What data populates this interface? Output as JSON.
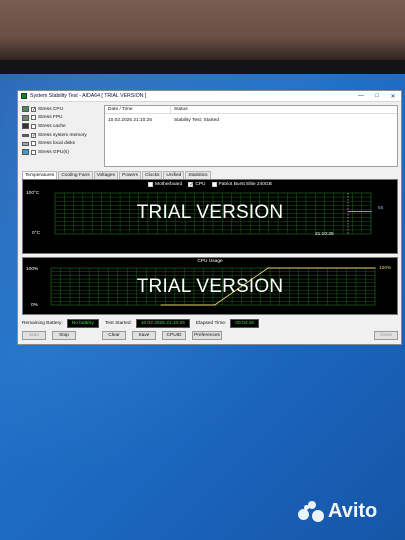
{
  "window": {
    "title": "System Stability Test - AIDA64  [ TRIAL VERSION ]",
    "minimize": "—",
    "maximize": "□",
    "close": "✕"
  },
  "options": [
    {
      "label": "Stress CPU",
      "checked": true
    },
    {
      "label": "Stress FPU",
      "checked": false
    },
    {
      "label": "Stress cache",
      "checked": false
    },
    {
      "label": "Stress system memory",
      "checked": true
    },
    {
      "label": "Stress local disks",
      "checked": false
    },
    {
      "label": "Stress GPU(s)",
      "checked": false
    }
  ],
  "log": {
    "col_date": "Date / Time",
    "col_status": "Status",
    "rows": [
      {
        "date": "10.02.2025 21:10:25",
        "status": "Stability Test: Started"
      }
    ]
  },
  "tabs": [
    "Temperatures",
    "Cooling Fans",
    "Voltages",
    "Powers",
    "Clocks",
    "Unified",
    "Statistics"
  ],
  "temp_chart": {
    "legend": [
      "Motherboard",
      "CPU",
      "Patriot Burst Elite 240GB"
    ],
    "legend_checked": [
      false,
      true,
      false
    ],
    "y_top": "100°C",
    "y_bottom": "0°C",
    "time_label": "21:10:25",
    "value_label": "55",
    "watermark": "TRIAL VERSION"
  },
  "cpu_chart": {
    "title": "CPU Usage",
    "y_top": "100%",
    "y_bottom": "0%",
    "value_label": "100%",
    "watermark": "TRIAL VERSION"
  },
  "status": {
    "battery_label": "Remaining Battery:",
    "battery_value": "No battery",
    "started_label": "Test Started:",
    "started_value": "10.02.2025 21:10:25",
    "elapsed_label": "Elapsed Time:",
    "elapsed_value": "00:04:18"
  },
  "buttons": {
    "start": "Start",
    "stop": "Stop",
    "clear": "Clear",
    "save": "Save",
    "cpuid": "CPUID",
    "preferences": "Preferences",
    "close": "Close"
  },
  "chart_data": [
    {
      "type": "line",
      "title": "",
      "series": [
        {
          "name": "CPU",
          "values": [
            55,
            55,
            55,
            55,
            55
          ]
        }
      ],
      "ylabel": "",
      "ylim": [
        0,
        100
      ],
      "grid": true
    },
    {
      "type": "line",
      "title": "CPU Usage",
      "series": [
        {
          "name": "",
          "values": [
            0,
            0,
            100,
            100,
            100
          ]
        }
      ],
      "ylim": [
        0,
        100
      ],
      "grid": true
    }
  ],
  "watermark": {
    "brand": "Avito"
  },
  "colors": {
    "grid": "#1f7a1f",
    "line_cpu": "#8ab0ff",
    "line_usage": "#e6d36a",
    "status_text": "#3ddc3d"
  }
}
